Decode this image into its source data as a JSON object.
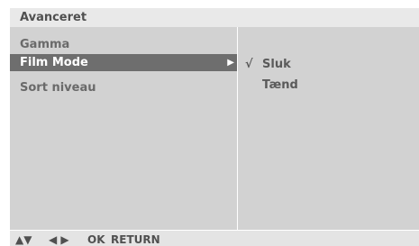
{
  "title": "Avanceret",
  "menu": {
    "items": [
      {
        "label": "Gamma"
      },
      {
        "label": "Film Mode"
      },
      {
        "label": "Sort niveau"
      }
    ],
    "selected_index": 1,
    "submenu_arrow": "▶"
  },
  "submenu": {
    "check_symbol": "√",
    "options": [
      {
        "label": "Sluk",
        "checked": true
      },
      {
        "label": "Tænd",
        "checked": false
      }
    ]
  },
  "footer": {
    "up_down": "▲▼",
    "left_right": "◀ ▶",
    "ok": "OK",
    "return": "RETURN"
  }
}
